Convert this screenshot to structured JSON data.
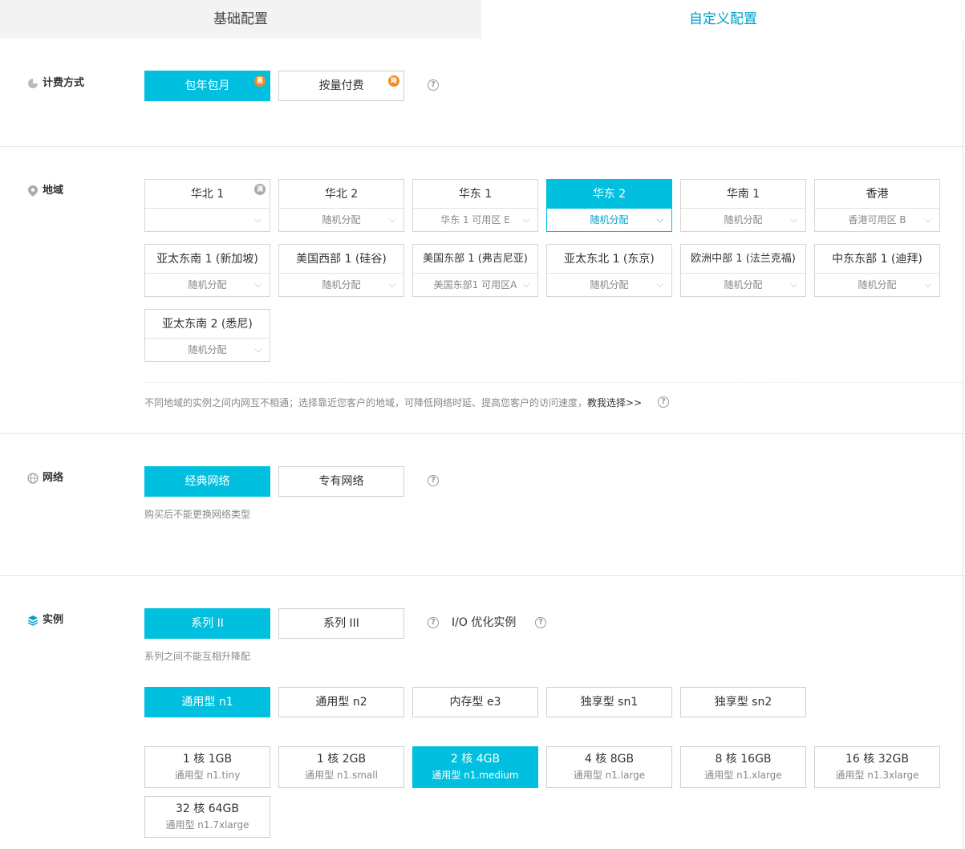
{
  "tabs": {
    "basic": "基础配置",
    "custom": "自定义配置"
  },
  "billing": {
    "label": "计费方式",
    "options": [
      {
        "label": "包年包月",
        "badge": "惠",
        "selected": true
      },
      {
        "label": "按量付费",
        "badge": "降",
        "selected": false
      }
    ]
  },
  "region": {
    "label": "地域",
    "items": [
      {
        "name": "华北 1",
        "zone": "",
        "badge": "满",
        "selected": false
      },
      {
        "name": "华北 2",
        "zone": "随机分配",
        "selected": false
      },
      {
        "name": "华东 1",
        "zone": "华东 1 可用区 E",
        "selected": false
      },
      {
        "name": "华东 2",
        "zone": "随机分配",
        "selected": true
      },
      {
        "name": "华南 1",
        "zone": "随机分配",
        "selected": false
      },
      {
        "name": "香港",
        "zone": "香港可用区 B",
        "selected": false
      },
      {
        "name": "亚太东南 1 (新加坡)",
        "zone": "随机分配",
        "selected": false
      },
      {
        "name": "美国西部 1 (硅谷)",
        "zone": "随机分配",
        "selected": false
      },
      {
        "name": "美国东部 1 (弗吉尼亚)",
        "zone": "美国东部1 可用区A",
        "selected": false
      },
      {
        "name": "亚太东北 1 (东京)",
        "zone": "随机分配",
        "selected": false
      },
      {
        "name": "欧洲中部 1 (法兰克福)",
        "zone": "随机分配",
        "selected": false
      },
      {
        "name": "中东东部 1 (迪拜)",
        "zone": "随机分配",
        "selected": false
      },
      {
        "name": "亚太东南 2 (悉尼)",
        "zone": "随机分配",
        "selected": false
      }
    ],
    "note": "不同地域的实例之间内网互不相通；选择靠近您客户的地域，可降低网络时延、提高您客户的访问速度，",
    "link": "教我选择>>"
  },
  "network": {
    "label": "网络",
    "options": [
      {
        "label": "经典网络",
        "selected": true
      },
      {
        "label": "专有网络",
        "selected": false
      }
    ],
    "note": "购买后不能更换网络类型"
  },
  "instance": {
    "label": "实例",
    "series": [
      {
        "label": "系列 II",
        "selected": true
      },
      {
        "label": "系列 III",
        "selected": false
      }
    ],
    "io_label": "I/O 优化实例",
    "series_note": "系列之间不能互相升降配",
    "families": [
      {
        "label": "通用型 n1",
        "selected": true
      },
      {
        "label": "通用型 n2",
        "selected": false
      },
      {
        "label": "内存型 e3",
        "selected": false
      },
      {
        "label": "独享型 sn1",
        "selected": false
      },
      {
        "label": "独享型 sn2",
        "selected": false
      }
    ],
    "specs": [
      {
        "main": "1 核 1GB",
        "sub": "通用型 n1.tiny",
        "selected": false
      },
      {
        "main": "1 核 2GB",
        "sub": "通用型 n1.small",
        "selected": false
      },
      {
        "main": "2 核 4GB",
        "sub": "通用型 n1.medium",
        "selected": true
      },
      {
        "main": "4 核 8GB",
        "sub": "通用型 n1.large",
        "selected": false
      },
      {
        "main": "8 核 16GB",
        "sub": "通用型 n1.xlarge",
        "selected": false
      },
      {
        "main": "16 核 32GB",
        "sub": "通用型 n1.3xlarge",
        "selected": false
      },
      {
        "main": "32 核 64GB",
        "sub": "通用型 n1.7xlarge",
        "selected": false
      }
    ]
  },
  "colors": {
    "accent": "#00bfdf",
    "tab_active": "#00a2ca",
    "badge": "#f08c1e"
  },
  "help_glyph": "?"
}
